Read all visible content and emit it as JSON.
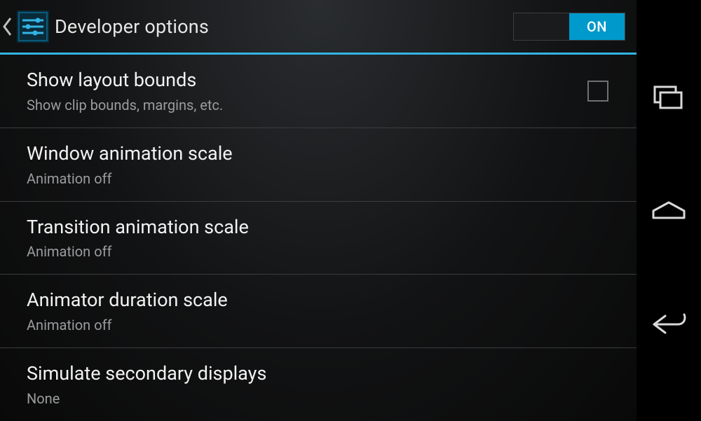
{
  "actionbar": {
    "title": "Developer options",
    "switch": {
      "on_label": "ON",
      "state": "on"
    }
  },
  "settings": [
    {
      "title": "Show layout bounds",
      "subtitle": "Show clip bounds, margins, etc.",
      "type": "checkbox",
      "checked": false
    },
    {
      "title": "Window animation scale",
      "subtitle": "Animation off",
      "type": "list"
    },
    {
      "title": "Transition animation scale",
      "subtitle": "Animation off",
      "type": "list"
    },
    {
      "title": "Animator duration scale",
      "subtitle": "Animation off",
      "type": "list"
    },
    {
      "title": "Simulate secondary displays",
      "subtitle": "None",
      "type": "list"
    }
  ]
}
